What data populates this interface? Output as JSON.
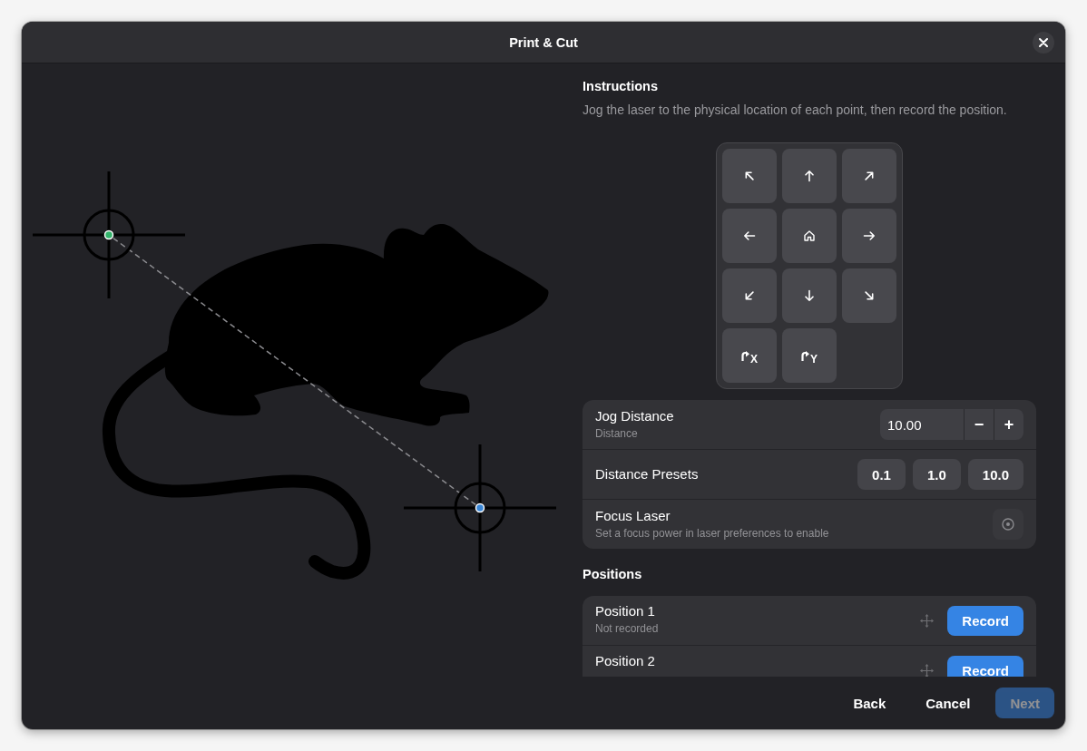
{
  "window": {
    "title": "Print & Cut"
  },
  "canvas": {
    "markers": [
      {
        "color": "#33b36b"
      },
      {
        "color": "#3a86d6"
      }
    ]
  },
  "instructions": {
    "heading": "Instructions",
    "text": "Jog the laser to the physical location of each point, then record the position."
  },
  "jog_pad": {
    "buttons": [
      {
        "kind": "northwest"
      },
      {
        "kind": "north"
      },
      {
        "kind": "northeast"
      },
      {
        "kind": "west"
      },
      {
        "kind": "home"
      },
      {
        "kind": "east"
      },
      {
        "kind": "southwest"
      },
      {
        "kind": "south"
      },
      {
        "kind": "southeast"
      },
      {
        "kind": "home_axis",
        "label": "X"
      },
      {
        "kind": "home_axis",
        "label": "Y"
      }
    ]
  },
  "settings": [
    {
      "kind": "spin",
      "title": "Jog Distance",
      "subtitle": "Distance",
      "value": "10.00",
      "minus": "−",
      "plus": "+"
    },
    {
      "kind": "presets",
      "title": "Distance Presets",
      "presets": [
        "0.1",
        "1.0",
        "10.0"
      ]
    },
    {
      "kind": "button",
      "title": "Focus Laser",
      "subtitle": "Set a focus power in laser preferences to enable",
      "disabled": true
    }
  ],
  "positions": {
    "heading": "Positions",
    "items": [
      {
        "title": "Position 1",
        "subtitle": "Not recorded",
        "action": "Record"
      },
      {
        "title": "Position 2",
        "action": "Record"
      }
    ]
  },
  "footer_buttons": [
    {
      "label": "Back",
      "kind": "flat",
      "disabled": false
    },
    {
      "label": "Cancel",
      "kind": "flat",
      "disabled": false
    },
    {
      "label": "Next",
      "kind": "suggested",
      "disabled": true
    }
  ]
}
